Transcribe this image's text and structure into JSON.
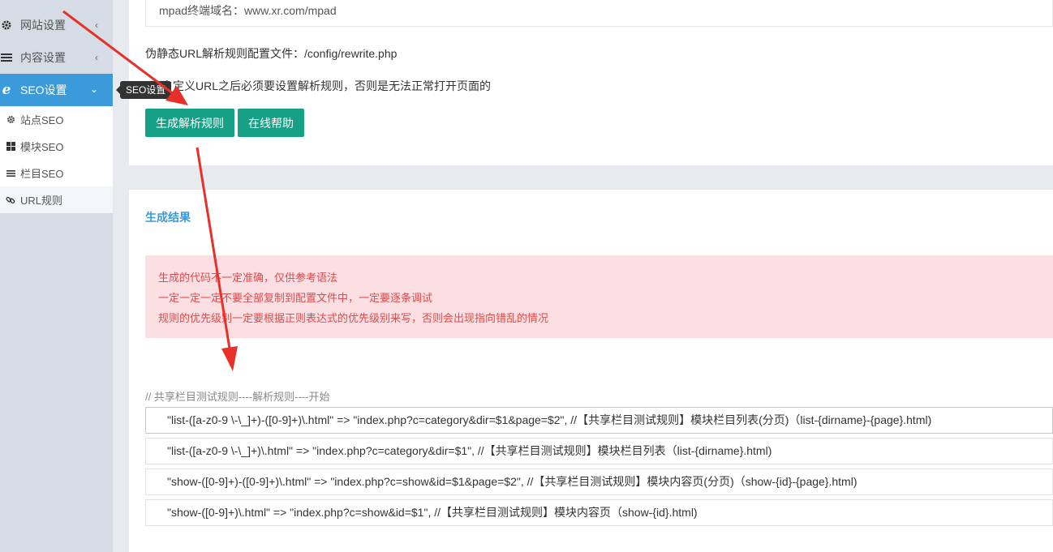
{
  "sidebar": {
    "items": [
      {
        "label": "网站设置",
        "icon": "gear-icon"
      },
      {
        "label": "内容设置",
        "icon": "list-icon"
      },
      {
        "label": "SEO设置",
        "icon": "ie-icon"
      }
    ],
    "submenu": [
      {
        "label": "站点SEO",
        "icon": "gear-icon"
      },
      {
        "label": "模块SEO",
        "icon": "grid-icon"
      },
      {
        "label": "栏目SEO",
        "icon": "list-icon"
      },
      {
        "label": "URL规则",
        "icon": "link-icon"
      }
    ],
    "tooltip": "SEO设置"
  },
  "config": {
    "domain_line": "mpad终端域名：www.xr.com/mpad",
    "rewrite_file": "伪静态URL解析规则配置文件：/config/rewrite.php",
    "notice": "用自定义URL之后必须要设置解析规则，否则是无法正常打开页面的",
    "generate_button": "生成解析规则",
    "help_button": "在线帮助"
  },
  "result": {
    "title": "生成结果",
    "alert_lines": [
      "生成的代码不一定准确，仅供参考语法",
      "一定一定一定不要全部复制到配置文件中，一定要逐条调试",
      "规则的优先级别一定要根据正则表达式的优先级别来写，否则会出现指向错乱的情况"
    ],
    "comment_start": "// 共享栏目测试规则----解析规则----开始",
    "rules": [
      "\"list-([a-z0-9 \\-\\_]+)-([0-9]+)\\.html\" => \"index.php?c=category&dir=$1&page=$2\",  //【共享栏目测试规则】模块栏目列表(分页)（list-{dirname}-{page}.html)",
      "\"list-([a-z0-9 \\-\\_]+)\\.html\" => \"index.php?c=category&dir=$1\",  //【共享栏目测试规则】模块栏目列表（list-{dirname}.html)",
      "\"show-([0-9]+)-([0-9]+)\\.html\" => \"index.php?c=show&id=$1&page=$2\",  //【共享栏目测试规则】模块内容页(分页)（show-{id}-{page}.html)",
      "\"show-([0-9]+)\\.html\" => \"index.php?c=show&id=$1\",  //【共享栏目测试规则】模块内容页（show-{id}.html)"
    ]
  },
  "colors": {
    "accent": "#3b9ad9",
    "button": "#16a085",
    "alert_bg": "#fcdfe3",
    "alert_text": "#e04a4a",
    "arrow": "#e8302a"
  }
}
